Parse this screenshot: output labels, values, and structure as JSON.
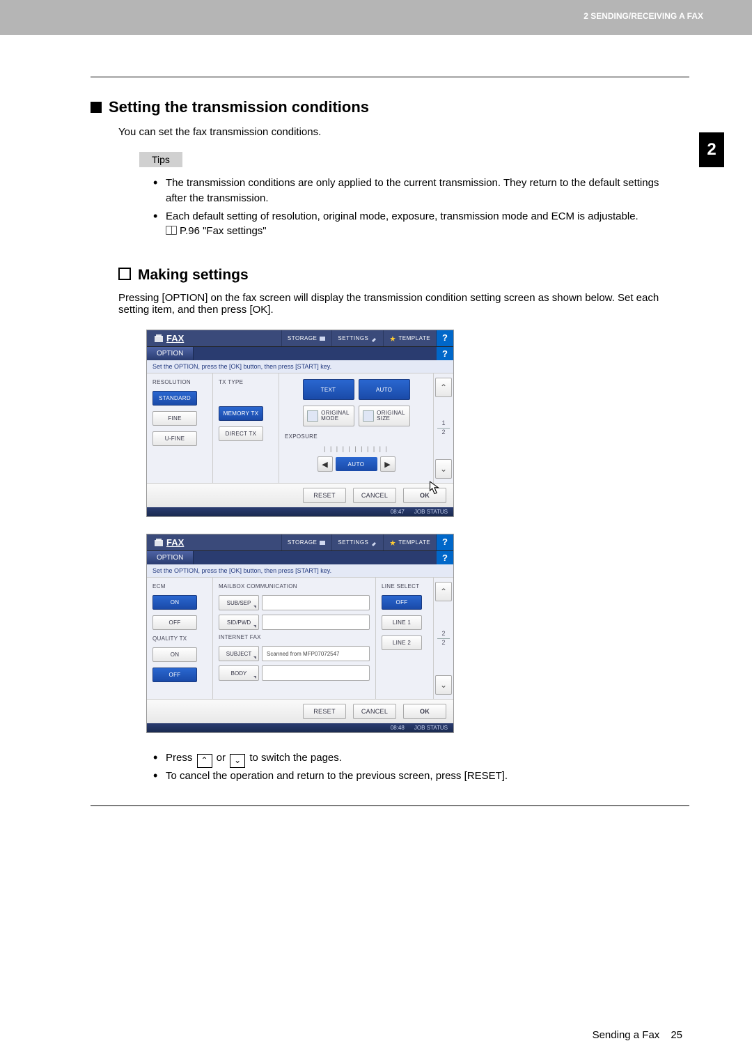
{
  "header": {
    "breadcrumb": "2 SENDING/RECEIVING A FAX",
    "chapter_tab": "2"
  },
  "section": {
    "title": "Setting the transmission conditions",
    "intro": "You can set the fax transmission conditions.",
    "tips_label": "Tips",
    "tips": [
      "The transmission conditions are only applied to the current transmission. They return to the default settings after the transmission.",
      "Each default setting of resolution, original mode, exposure, transmission mode and ECM is adjustable."
    ],
    "xref": "P.96 \"Fax settings\""
  },
  "subsection": {
    "title": "Making settings",
    "intro": "Pressing [OPTION] on the fax screen will display the transmission condition setting screen as shown below. Set each setting item, and then press [OK]."
  },
  "panel_common": {
    "fax_label": "FAX",
    "storage": "STORAGE",
    "settings": "SETTINGS",
    "template": "TEMPLATE",
    "help": "?",
    "option_tab": "OPTION",
    "hint": "Set the OPTION, press the [OK] button, then press [START] key.",
    "reset": "RESET",
    "cancel": "CANCEL",
    "ok": "OK",
    "jobstatus": "JOB STATUS"
  },
  "panel1": {
    "resolution_label": "RESOLUTION",
    "standard": "STANDARD",
    "fine": "FINE",
    "ufine": "U-FINE",
    "txtype_label": "TX TYPE",
    "memory_tx": "MEMORY TX",
    "direct_tx": "DIRECT TX",
    "text": "TEXT",
    "auto": "AUTO",
    "orig_mode": "ORIGINAL\nMODE",
    "orig_size": "ORIGINAL\nSIZE",
    "exposure": "EXPOSURE",
    "page_cur": "1",
    "page_tot": "2",
    "time": "08:47"
  },
  "panel2": {
    "ecm_label": "ECM",
    "on": "ON",
    "off": "OFF",
    "quality_label": "QUALITY TX",
    "mailbox_label": "MAILBOX COMMUNICATION",
    "sub_sep": "SUB/SEP",
    "sid_pwd": "SID/PWD",
    "ifax_label": "INTERNET FAX",
    "subject": "SUBJECT",
    "subject_value": "Scanned from MFP07072547",
    "body": "BODY",
    "line_label": "LINE SELECT",
    "line_off": "OFF",
    "line1": "LINE 1",
    "line2": "LINE 2",
    "page_cur": "2",
    "page_tot": "2",
    "time": "08:48"
  },
  "post": {
    "press_a": "Press ",
    "press_b": " or ",
    "press_c": " to switch the pages.",
    "line2": "To cancel the operation and return to the previous screen, press [RESET]."
  },
  "footer": {
    "section": "Sending a Fax",
    "page": "25"
  }
}
